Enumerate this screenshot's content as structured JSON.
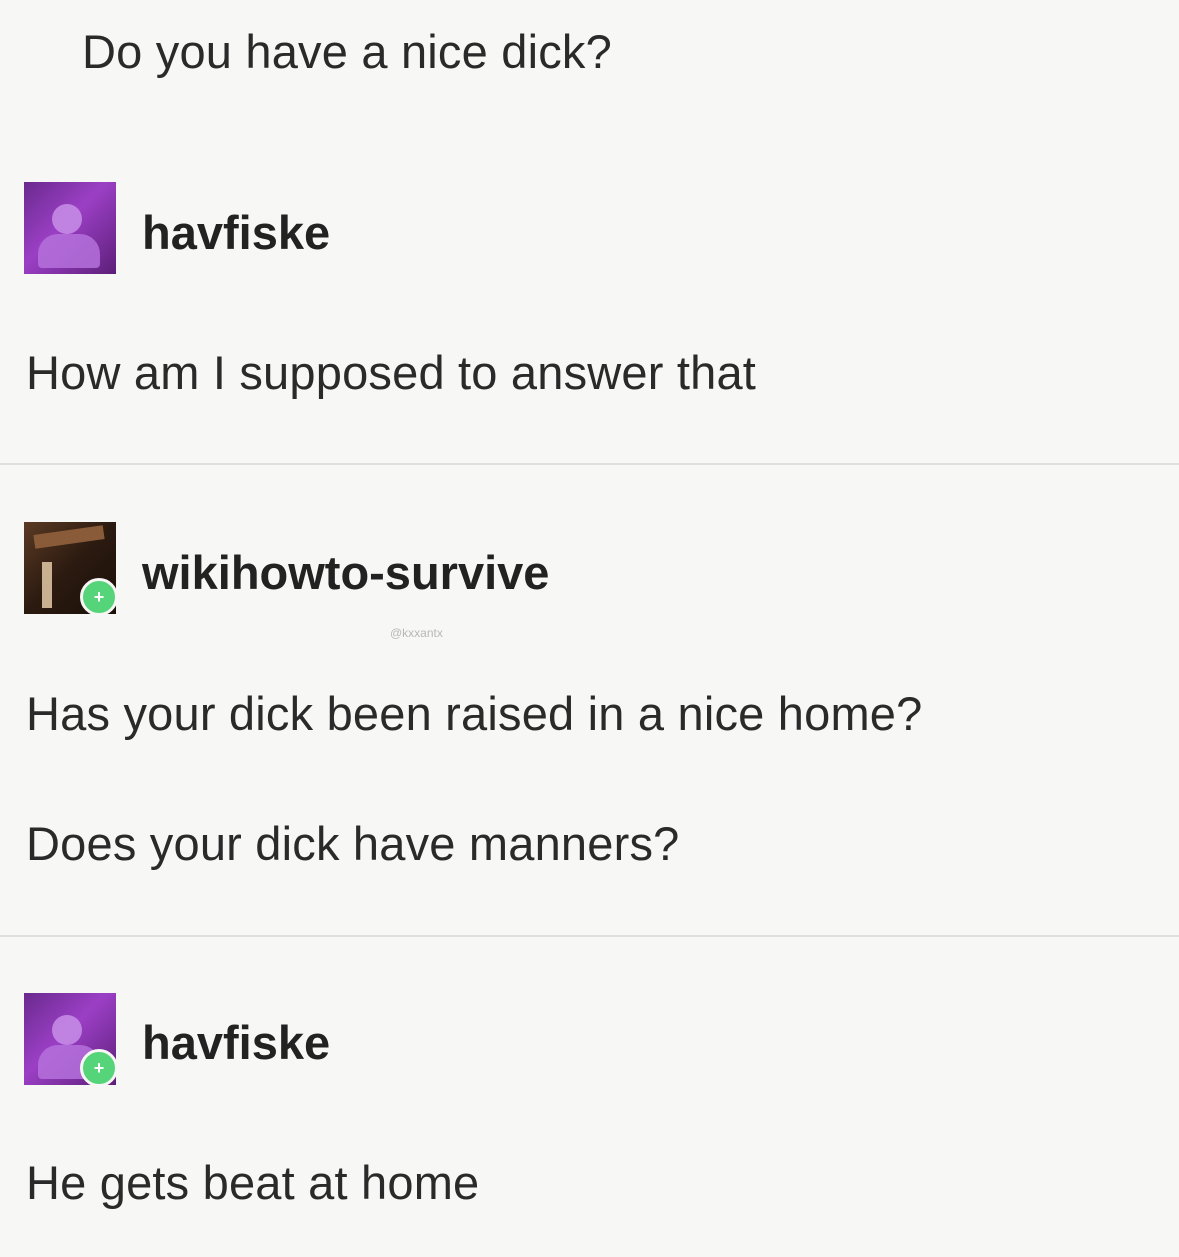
{
  "posts": [
    {
      "text": "Do you have a nice dick?"
    },
    {
      "username": "havfiske",
      "avatar_icon": "purple-avatar-icon",
      "lines": [
        "How am I supposed to answer that"
      ]
    },
    {
      "username": "wikihowto-survive",
      "avatar_icon": "dark-avatar-icon",
      "badge_icon": "green-follow-badge-icon",
      "faint_label": "@kxxantx",
      "lines": [
        "Has your dick been raised in a nice home?",
        "Does your dick have manners?"
      ]
    },
    {
      "username": "havfiske",
      "avatar_icon": "purple-avatar-icon",
      "badge_icon": "green-follow-badge-icon",
      "lines": [
        "He gets beat at home"
      ]
    }
  ],
  "colors": {
    "background": "#f7f7f5",
    "text": "#2a2a2a",
    "divider": "#e0e0de",
    "badge": "#56d47a"
  }
}
